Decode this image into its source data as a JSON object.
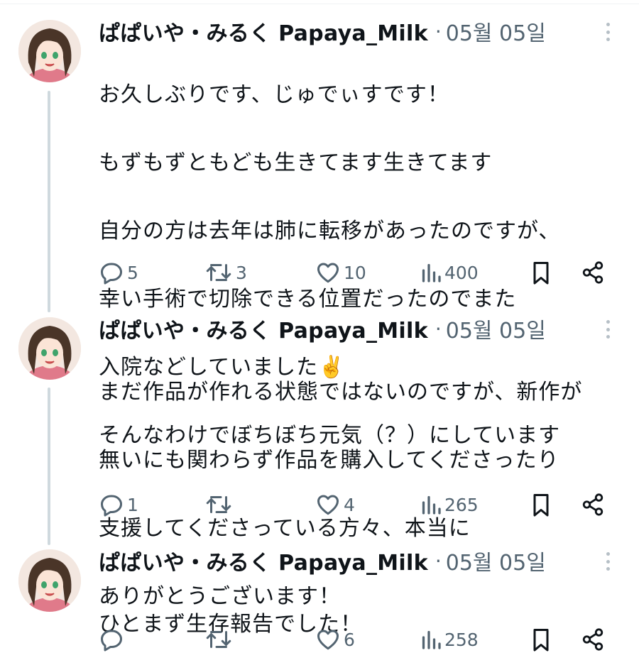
{
  "author": {
    "display_name": "ぱぱいや・みるく Papaya_Milk"
  },
  "colors": {
    "text_primary": "#0f1419",
    "text_secondary": "#536471",
    "thread_line": "#cfd9de",
    "more_dots": "#b6bfc6"
  },
  "separator": "·",
  "tweets": [
    {
      "timestamp": "05월 05일",
      "text_lines": [
        "お久しぶりです、じゅでぃすです！",
        "もずもずともども生きてます生きてます",
        "自分の方は去年は肺に転移があったのですが、",
        "幸い手術で切除できる位置だったのでまた",
        "入院などしていました✌️",
        "そんなわけでぼちぼち元気（？）にしています"
      ],
      "replies": "5",
      "retweets": "3",
      "likes": "10",
      "views": "400"
    },
    {
      "timestamp": "05월 05일",
      "text_lines": [
        "まだ作品が作れる状態ではないのですが、新作が",
        "無いにも関わらず作品を購入してくださったり",
        "支援してくださっている方々、本当に",
        "ありがとうございます！"
      ],
      "replies": "1",
      "retweets": "",
      "likes": "4",
      "views": "265"
    },
    {
      "timestamp": "05월 05일",
      "text_lines": [
        "ひとまず生存報告でした！"
      ],
      "replies": "",
      "retweets": "",
      "likes": "6",
      "views": "258"
    }
  ],
  "icons": {
    "reply": "reply-icon",
    "retweet": "retweet-icon",
    "like": "heart-icon",
    "views": "views-icon",
    "bookmark": "bookmark-icon",
    "share": "share-icon",
    "more": "more-icon"
  }
}
